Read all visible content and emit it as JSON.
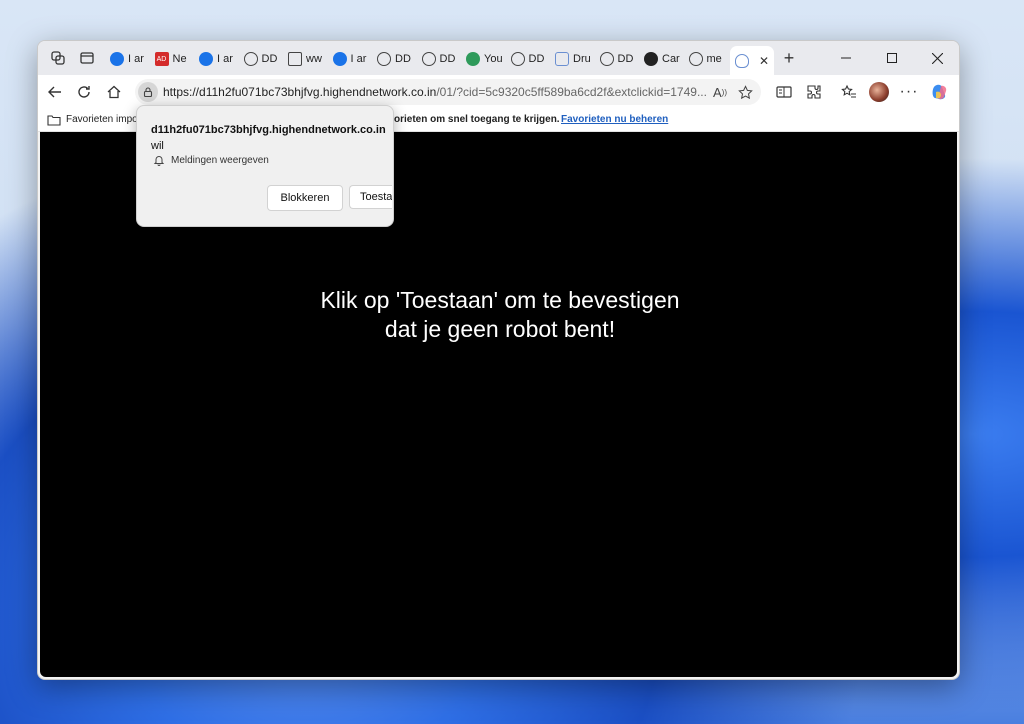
{
  "browser": {
    "tabs": [
      {
        "label": "I ar",
        "icon": "download-icon",
        "color": "#1a73e8"
      },
      {
        "label": "Ne",
        "icon": "ad-icon",
        "color": "#d42b2b"
      },
      {
        "label": "I ar",
        "icon": "download-icon",
        "color": "#1a73e8"
      },
      {
        "label": "DD",
        "icon": "globe-icon",
        "color": "#444444"
      },
      {
        "label": "ww",
        "icon": "file-icon",
        "color": "#444444"
      },
      {
        "label": "I ar",
        "icon": "download-icon",
        "color": "#1a73e8"
      },
      {
        "label": "DD",
        "icon": "globe-icon",
        "color": "#444444"
      },
      {
        "label": "DD",
        "icon": "globe-icon",
        "color": "#444444"
      },
      {
        "label": "You",
        "icon": "green-circle-icon",
        "color": "#2e9a5b"
      },
      {
        "label": "DD",
        "icon": "globe-icon",
        "color": "#444444"
      },
      {
        "label": "Dru",
        "icon": "shape-icon",
        "color": "#6a8fd1"
      },
      {
        "label": "DD",
        "icon": "globe-icon",
        "color": "#444444"
      },
      {
        "label": "Car",
        "icon": "dark-face-icon",
        "color": "#222222"
      },
      {
        "label": "me",
        "icon": "globe-icon",
        "color": "#444444"
      }
    ],
    "url_main": "https://d11h2fu071bc73bhjfvg.highendnetwork.co.in",
    "url_rest": "/01/?cid=5c9320c5ff589ba6cd2f&extclickid=1749...",
    "favorites_left": "Favorieten impo",
    "favorites_middle": "orieten om snel toegang te krijgen.",
    "favorites_link": "Favorieten nu beheren"
  },
  "popup": {
    "domain": "d11h2fu071bc73bhjfvg.highendnetwork.co.in",
    "wil": "wil",
    "request": "Meldingen weergeven",
    "block_label": "Blokkeren",
    "allow_label": "Toesta"
  },
  "page": {
    "message": "Klik op 'Toestaan' om te bevestigen dat je geen robot bent!"
  }
}
